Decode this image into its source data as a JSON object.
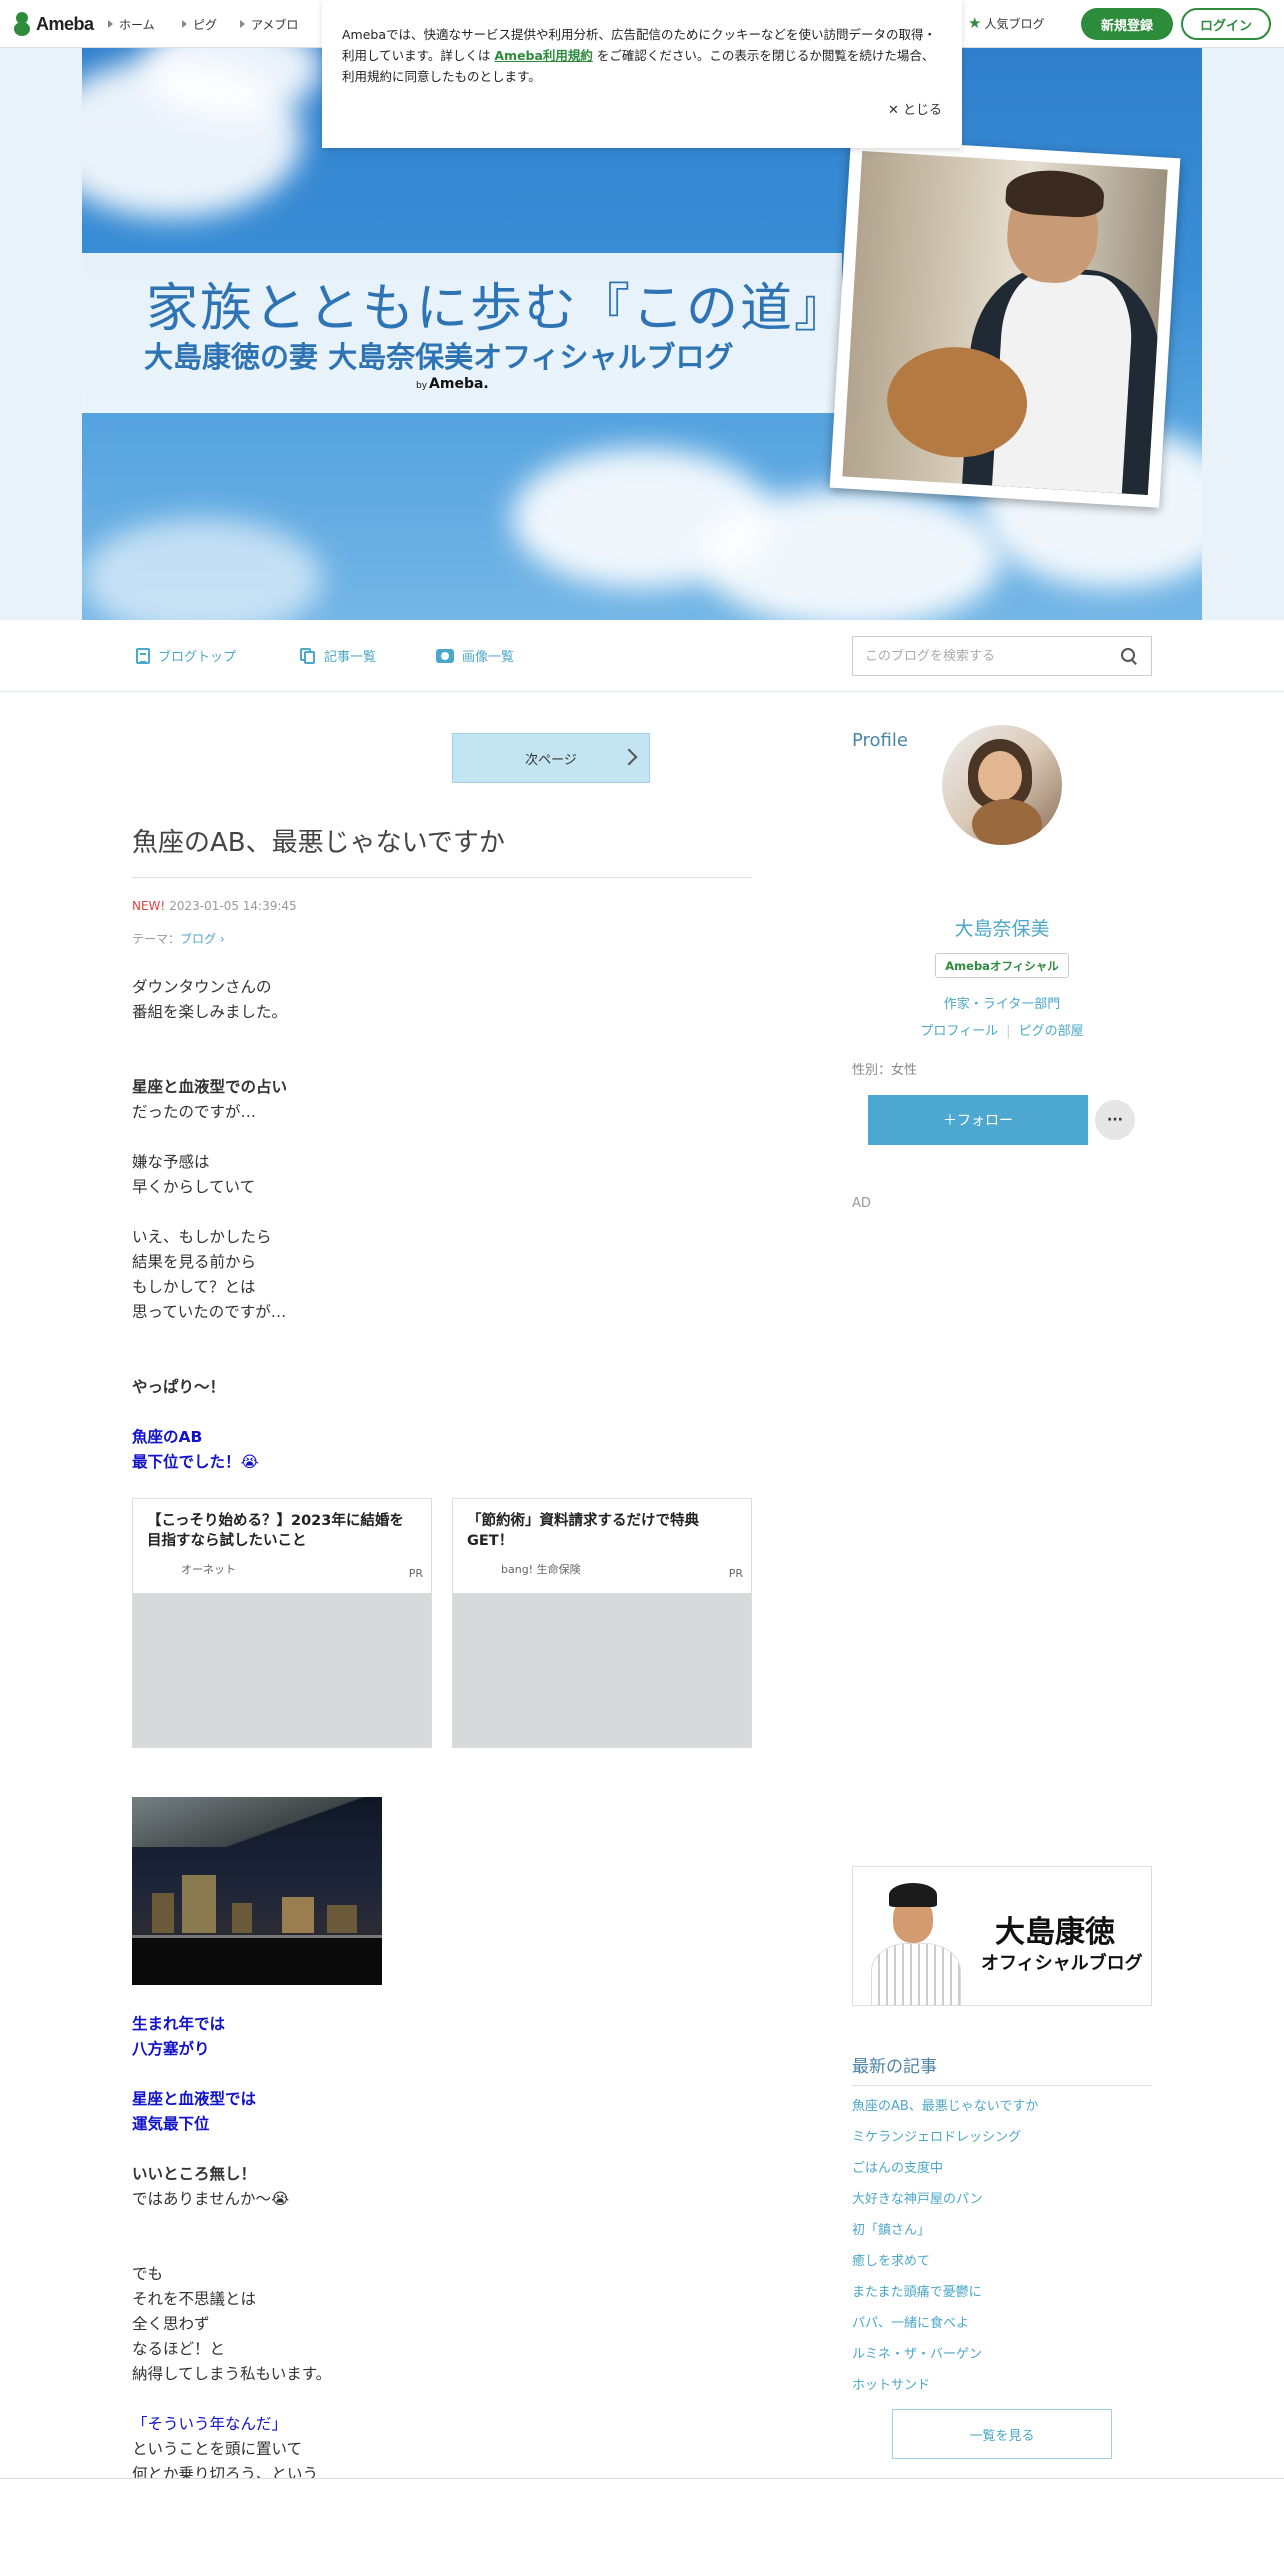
{
  "topnav": {
    "logo": "Ameba",
    "links": [
      "ホーム",
      "ピグ",
      "アメブロ"
    ],
    "popular": "人気ブログ",
    "signup": "新規登録",
    "login": "ログイン"
  },
  "cookie": {
    "text1": "Amebaでは、快適なサービス提供や利用分析、広告配信のためにクッキーなどを使い訪問データの取得・利用しています。詳しくは",
    "link": "Ameba利用規約",
    "text2": "をご確認ください。この表示を閉じるか閲覧を続けた場合、利用規約に同意したものとします。",
    "close": "とじる"
  },
  "hero": {
    "title": "家族とともに歩む『この道』",
    "subtitle": "大島康徳の妻 大島奈保美オフィシャルブログ",
    "by": "by",
    "brand": "Ameba."
  },
  "subnav": {
    "blog_top": "ブログトップ",
    "articles": "記事一覧",
    "images": "画像一覧",
    "search_placeholder": "このブログを検索する"
  },
  "main": {
    "next_page": "次ページ",
    "title": "魚座のAB、最悪じゃないですか",
    "new_badge": "NEW!",
    "date": "2023-01-05 14:39:45",
    "theme_label": "テーマ：",
    "theme": "ブログ",
    "p1": "ダウンタウンさんの\n番組を楽しみました。",
    "p2": "星座と血液型での占い",
    "p3": "だったのですが…\n\n嫌な予感は\n早くからしていて\n\nいえ、もしかしたら\n結果を見る前から\nもしかして？とは\n思っていたのですが…",
    "p4": "やっぱり〜！",
    "p5": "魚座のAB\n最下位でした！😭",
    "p6": "生まれ年では\n八方塞がり\n\n星座と血液型では\n運気最下位",
    "p7": "いいところ無し！",
    "p8": "ではありませんか〜😭\n\n\nでも\nそれを不思議とは\n全く思わず\nなるほど！と\n納得してしまう私もいます。",
    "p9": "「そういう年なんだ」",
    "p10": "ということを頭に置いて\n何とか乗り切ろう、という"
  },
  "ads": [
    {
      "title": "【こっそり始める？】2023年に結婚を目指すなら試したいこと",
      "sponsor": "オーネット",
      "pr": "PR"
    },
    {
      "title": "「節約術」資料請求するだけで特典GET！",
      "sponsor": "bang! 生命保険",
      "pr": "PR"
    }
  ],
  "sidebar": {
    "profile_heading": "Profile",
    "name": "大島奈保美",
    "official": "Amebaオフィシャル",
    "category": "作家・ライター部門",
    "profile_link": "プロフィール",
    "room_link": "ピグの部屋",
    "gender": "性別：女性",
    "follow": "＋フォロー",
    "more": "···",
    "ad": "AD",
    "banner_name": "大島康徳",
    "banner_sub": "オフィシャルブログ",
    "latest_heading": "最新の記事",
    "latest": [
      "魚座のAB、最悪じゃないですか",
      "ミケランジェロドレッシング",
      "ごはんの支度中",
      "大好きな神戸屋のパン",
      "初「鎮さん」",
      "癒しを求めて",
      "またまた頭痛で憂鬱に",
      "パパ、一緒に食べよ",
      "ルミネ・ザ・バーゲン",
      "ホットサンド"
    ],
    "view_all": "一覧を見る"
  },
  "colors": {
    "ameba_green": "#2d8c3c",
    "accent_blue": "#4ca8c8",
    "text_blue": "#1111cc",
    "new_red": "#e0433f"
  }
}
